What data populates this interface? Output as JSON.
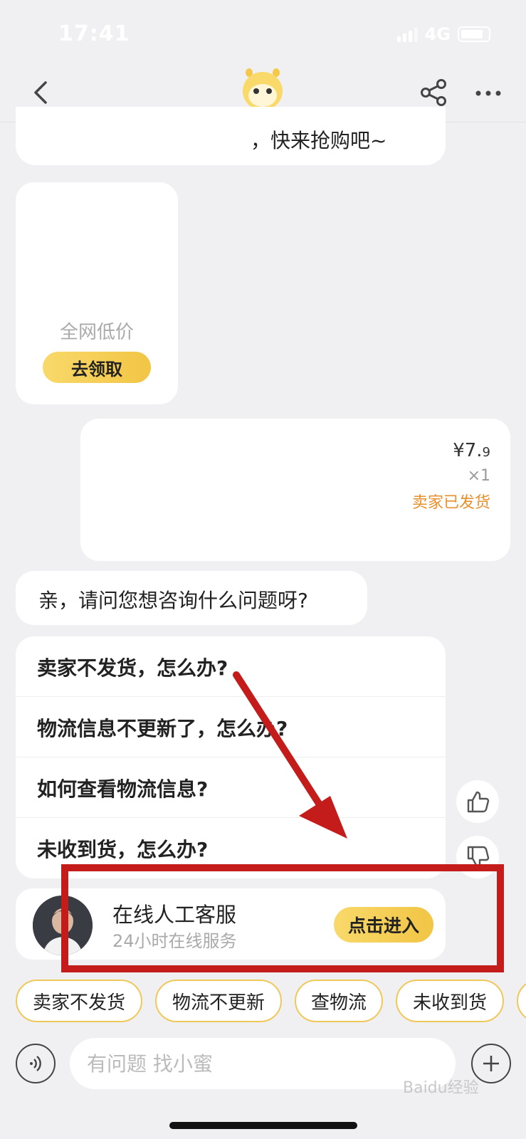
{
  "status_bar": {
    "time": "17:41",
    "network": "4G"
  },
  "nav": {
    "back_icon": "chevron-left-icon",
    "logo_icon": "mascot-logo-icon",
    "share_icon": "share-icon",
    "more_icon": "more-dots-icon"
  },
  "messages": {
    "top_bubble_text": "，快来抢购吧~",
    "coupon": {
      "label": "全网低价",
      "button": "去领取"
    },
    "order": {
      "price_symbol": "¥",
      "price_main": "7.",
      "price_decimal": "9",
      "quantity": "×1",
      "status": "卖家已发货"
    },
    "question": "亲，请问您想咨询什么问题呀?"
  },
  "faq": {
    "items": [
      {
        "label": "卖家不发货，怎么办?"
      },
      {
        "label": "物流信息不更新了，怎么办?"
      },
      {
        "label": "如何查看物流信息?"
      },
      {
        "label": "未收到货，怎么办?"
      }
    ]
  },
  "feedback": {
    "like_icon": "thumbs-up-icon",
    "dislike_icon": "thumbs-down-icon"
  },
  "agent": {
    "title": "在线人工客服",
    "subtitle": "24小时在线服务",
    "button": "点击进入"
  },
  "quick_chips": [
    {
      "label": "卖家不发货"
    },
    {
      "label": "物流不更新"
    },
    {
      "label": "查物流"
    },
    {
      "label": "未收到货"
    }
  ],
  "input": {
    "placeholder": "有问题 找小蜜"
  },
  "watermark": "Baidu经验",
  "colors": {
    "accent_yellow": "#f2c545",
    "highlight_red": "#c41b1b",
    "status_orange": "#e8902c"
  }
}
